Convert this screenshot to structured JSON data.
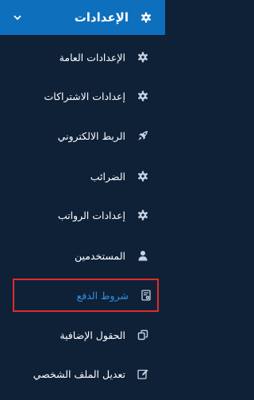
{
  "header": {
    "label": "الإعدادات",
    "icon": "gear-icon",
    "toggle_icon": "chevron-down-icon"
  },
  "items": [
    {
      "label": "الإعدادات العامة",
      "icon": "gear-icon"
    },
    {
      "label": "إعدادات الاشتراكات",
      "icon": "gear-icon"
    },
    {
      "label": "الربط الالكتروني",
      "icon": "rocket-icon"
    },
    {
      "label": "الضرائب",
      "icon": "gear-icon"
    },
    {
      "label": "إعدادات الرواتب",
      "icon": "gear-icon"
    },
    {
      "label": "المستخدمين",
      "icon": "user-icon"
    },
    {
      "label": "شروط الدفع",
      "icon": "payment-terms-icon",
      "selected": true
    },
    {
      "label": "الحقول الإضافية",
      "icon": "copy-fields-icon"
    },
    {
      "label": "تعديل الملف الشخصي",
      "icon": "edit-profile-icon"
    }
  ],
  "colors": {
    "sidebar_bg": "#0f2137",
    "header_bg": "#0e6fbd",
    "text": "#ffffff",
    "icon": "#c9d3de",
    "selected_text": "#2f92e6",
    "highlight_border": "#e22b2b"
  }
}
